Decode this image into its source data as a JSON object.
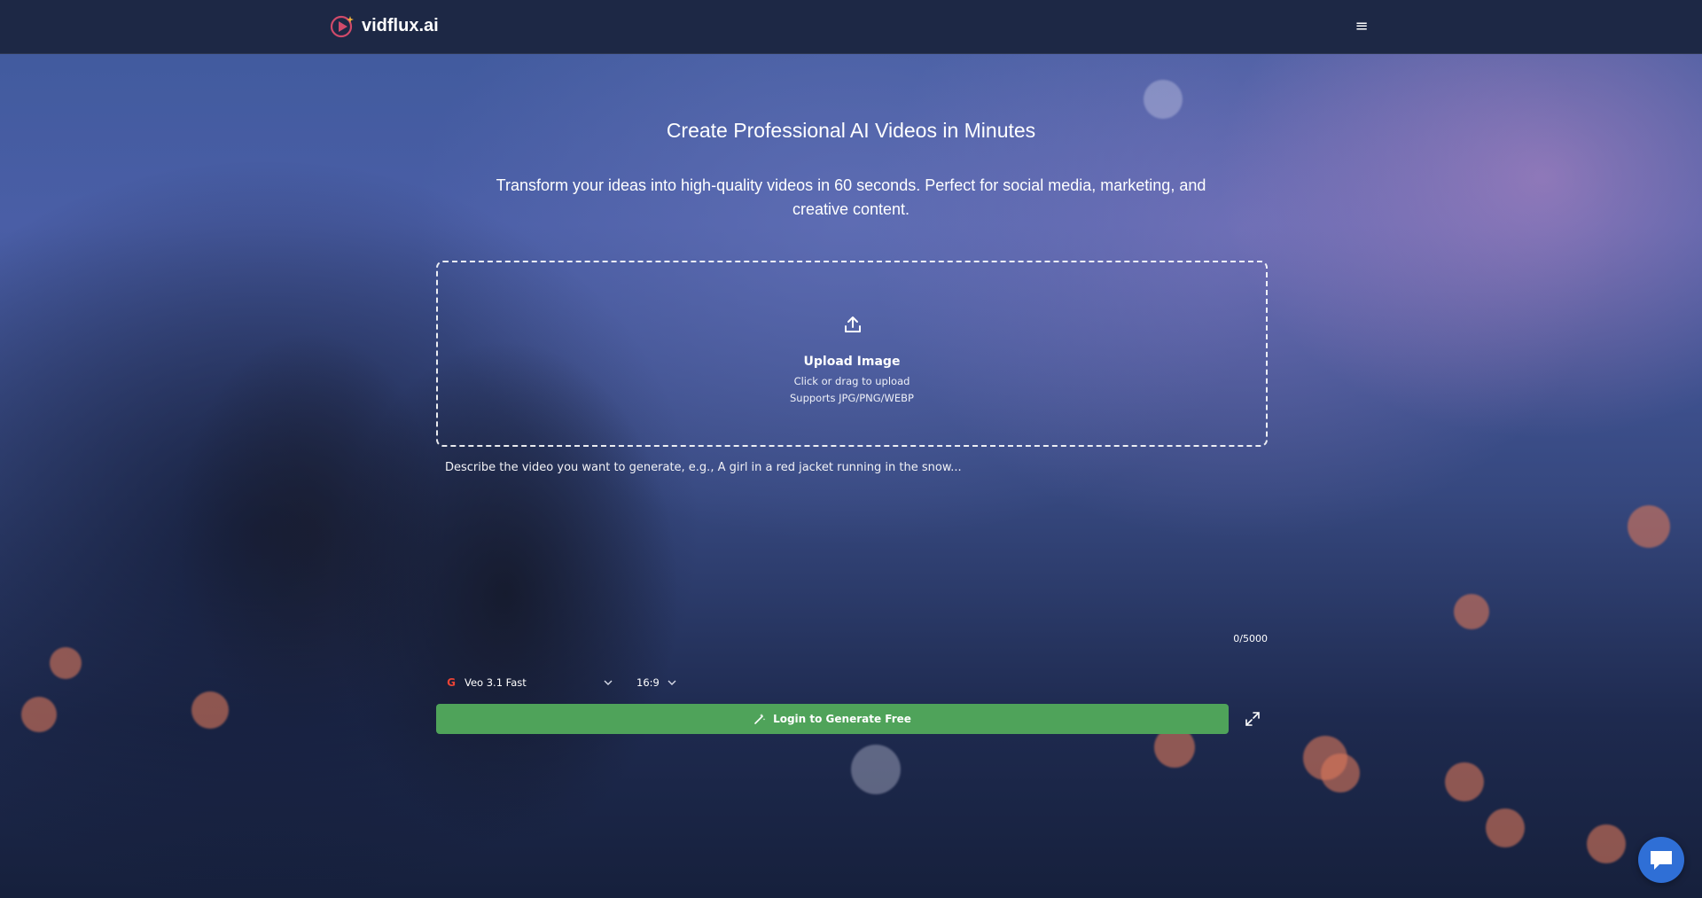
{
  "header": {
    "brand": "vidflux.ai",
    "menu_glyph": "≡"
  },
  "hero": {
    "title": "Create Professional AI Videos in Minutes",
    "subtitle": "Transform your ideas into high-quality videos in 60 seconds. Perfect for social media, marketing, and creative content."
  },
  "upload": {
    "icon": "upload-icon",
    "title": "Upload Image",
    "hint": "Click or drag to upload",
    "formats": "Supports JPG/PNG/WEBP"
  },
  "prompt": {
    "value": "",
    "placeholder": "Describe the video you want to generate, e.g., A girl in a red jacket running in the snow...",
    "char_count": "0/5000"
  },
  "controls": {
    "model": "Veo 3.1 Fast",
    "model_icon_glyph": "G",
    "aspect_ratio": "16:9"
  },
  "actions": {
    "generate_label": "Login to Generate Free"
  },
  "colors": {
    "header_bg": "#1d2845",
    "generate_button": "#4fa35a",
    "chat_button": "#2f6fd6"
  }
}
